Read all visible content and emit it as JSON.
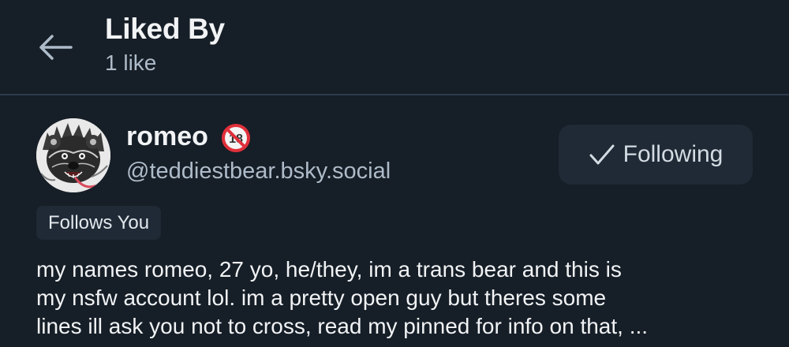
{
  "header": {
    "title": "Liked By",
    "subtitle": "1 like",
    "back_icon": "arrow-left-icon"
  },
  "profile": {
    "display_name": "romeo",
    "adult_badge_icon": "18-plus-icon",
    "handle": "@teddiestbear.bsky.social",
    "follow_button_label": "Following",
    "follow_button_icon": "check-icon",
    "follows_you_label": "Follows You",
    "bio_lines": [
      "my names romeo, 27 yo, he/they, im a trans bear and this is",
      "my nsfw account lol. im a pretty open guy but theres some",
      "lines ill ask you not to cross, read my pinned for info on that, ..."
    ]
  },
  "colors": {
    "background": "#161e27",
    "button_bg": "#1f2a36",
    "muted_text": "#aebbc9",
    "badge_red": "#e0303b"
  }
}
